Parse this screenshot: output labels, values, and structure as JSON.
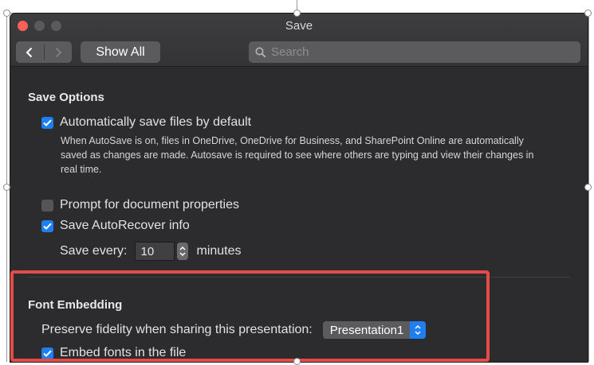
{
  "window": {
    "title": "Save",
    "nav": {
      "back_icon": "chevron-left-icon",
      "forward_icon": "chevron-right-icon"
    },
    "show_all_label": "Show All",
    "search": {
      "placeholder": "Search",
      "icon": "search-icon"
    }
  },
  "save_options": {
    "heading": "Save Options",
    "autosave": {
      "label": "Automatically save files by default",
      "checked": true,
      "description": "When AutoSave is on, files in OneDrive, OneDrive for Business, and SharePoint Online are automatically saved as changes are made. Autosave is required to see where others are typing and view their changes in real time."
    },
    "prompt_properties": {
      "label": "Prompt for document properties",
      "checked": false
    },
    "autorecover": {
      "label": "Save AutoRecover info",
      "checked": true
    },
    "save_every": {
      "label": "Save every:",
      "value": "10",
      "unit": "minutes"
    }
  },
  "font_embedding": {
    "heading": "Font Embedding",
    "preserve_label": "Preserve fidelity when sharing this presentation:",
    "presentation_value": "Presentation1",
    "embed": {
      "label": "Embed fonts in the file",
      "checked": true
    }
  },
  "colors": {
    "accent": "#1f7ff0",
    "close_button": "#fe5f57",
    "highlight_border": "#e44c4a",
    "window_bg": "#2c2c2e"
  }
}
